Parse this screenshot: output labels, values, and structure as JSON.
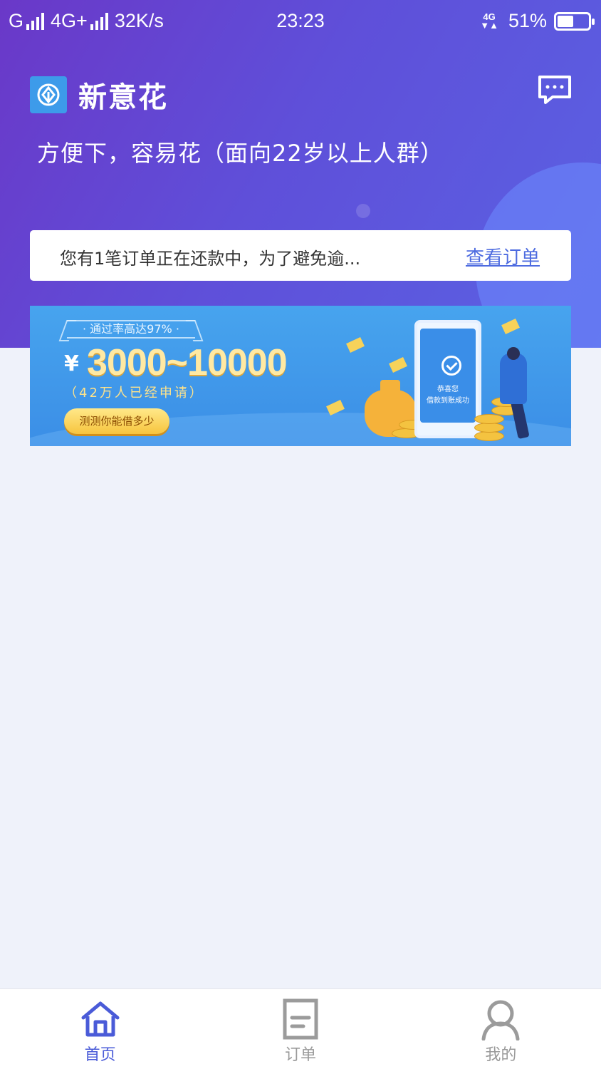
{
  "status_bar": {
    "carrier1": "G",
    "carrier2": "4G+",
    "speed": "32K/s",
    "time": "23:23",
    "net": "4G",
    "battery": "51%",
    "battery_level": 0.51
  },
  "header": {
    "app_title": "新意花",
    "slogan": "方便下，容易花（面向22岁以上人群）"
  },
  "notice": {
    "text": "您有1笔订单正在还款中，为了避免逾...",
    "link": "查看订单"
  },
  "banner": {
    "tag": "· 通过率高达97% ·",
    "yen": "¥",
    "amount": "3000~10000",
    "sub": "（42万人已经申请）",
    "button": "测测你能借多少",
    "phone_line1": "恭喜您",
    "phone_line2": "借款到账成功"
  },
  "bottom_nav": {
    "items": [
      {
        "label": "首页",
        "icon": "home-icon",
        "active": true
      },
      {
        "label": "订单",
        "icon": "order-icon",
        "active": false
      },
      {
        "label": "我的",
        "icon": "profile-icon",
        "active": false
      }
    ]
  },
  "colors": {
    "brand_purple": "#6a38c8",
    "brand_blue": "#5a62e3",
    "link_blue": "#4d6be0",
    "active_nav": "#4a5bd8",
    "page_bg": "#eff2fa"
  }
}
